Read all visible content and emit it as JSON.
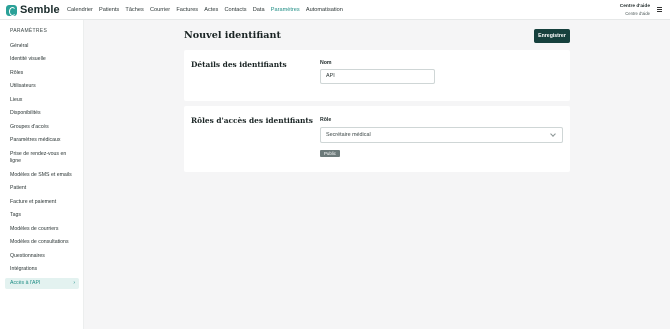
{
  "brand": {
    "name": "Semble"
  },
  "nav": {
    "items": [
      {
        "label": "Calendrier"
      },
      {
        "label": "Patients"
      },
      {
        "label": "Tâches"
      },
      {
        "label": "Courrier"
      },
      {
        "label": "Factures"
      },
      {
        "label": "Actes"
      },
      {
        "label": "Contacts"
      },
      {
        "label": "Data"
      },
      {
        "label": "Paramètres",
        "active": true
      },
      {
        "label": "Automatisation"
      }
    ]
  },
  "help": {
    "title": "Centre d'aide",
    "subtitle": "Centre d'aide"
  },
  "sidebar": {
    "title": "PARAMÈTRES",
    "items": [
      {
        "label": "Général"
      },
      {
        "label": "Identité visuelle"
      },
      {
        "label": "Rôles"
      },
      {
        "label": "Utilisateurs"
      },
      {
        "label": "Lieux"
      },
      {
        "label": "Disponibilités"
      },
      {
        "label": "Groupes d'accès"
      },
      {
        "label": "Paramètres médicaux"
      },
      {
        "label": "Prise de rendez-vous en"
      },
      {
        "label": "ligne"
      },
      {
        "label": "Modèles de SMS et emails"
      },
      {
        "label": "Patient"
      },
      {
        "label": "Facture et paiement"
      },
      {
        "label": "Tags"
      },
      {
        "label": "Modèles de courriers"
      },
      {
        "label": "Modèles de consultations"
      },
      {
        "label": "Questionnaires"
      },
      {
        "label": "Intégrations"
      },
      {
        "label": "Accès à l'API",
        "active": true
      }
    ],
    "active_chevron": "›"
  },
  "main": {
    "title": "Nouvel identifiant",
    "save_label": "Enregistrer",
    "details": {
      "title": "Détails des identifiants",
      "name_label": "Nom",
      "name_value": "API"
    },
    "roles": {
      "title": "Rôles d'accès des identifiants",
      "role_label": "Rôle",
      "role_value": "Secrétaire médical",
      "badge": "Public"
    }
  },
  "colors": {
    "accent": "#1c8c83",
    "brand": "#2aa198",
    "primary_button": "#16403d",
    "active_bg": "#e3f2f0"
  }
}
